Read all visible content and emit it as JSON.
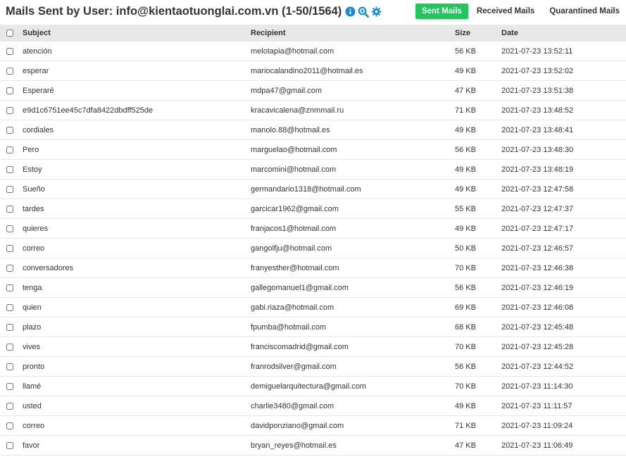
{
  "header": {
    "title": "Mails Sent by User: info@kientaotuonglai.com.vn (1-50/1564)",
    "icons": [
      "info-icon",
      "search-zoom-icon",
      "gear-icon"
    ],
    "accent_color": "#22c55e",
    "icon_color": "#1d8acb"
  },
  "tabs": [
    {
      "label": "Sent Mails",
      "active": true
    },
    {
      "label": "Received Mails",
      "active": false
    },
    {
      "label": "Quarantined Mails",
      "active": false
    }
  ],
  "table": {
    "columns": [
      "Subject",
      "Recipient",
      "Size",
      "Date"
    ],
    "rows": [
      {
        "subject": "atención",
        "recipient": "melotapia@hotmail.com",
        "size": "56 KB",
        "date": "2021-07-23 13:52:11"
      },
      {
        "subject": "esperar",
        "recipient": "mariocalandino2011@hotmail.es",
        "size": "49 KB",
        "date": "2021-07-23 13:52:02"
      },
      {
        "subject": "Esperaré",
        "recipient": "mdpa47@gmail.com",
        "size": "47 KB",
        "date": "2021-07-23 13:51:38"
      },
      {
        "subject": "e9d1c6751ee45c7dfa8422dbdff525de",
        "recipient": "kracavicalena@znmmail.ru",
        "size": "71 KB",
        "date": "2021-07-23 13:48:52"
      },
      {
        "subject": "cordiales",
        "recipient": "manolo.88@hotmail.es",
        "size": "49 KB",
        "date": "2021-07-23 13:48:41"
      },
      {
        "subject": "Pero",
        "recipient": "marguelao@hotmail.com",
        "size": "56 KB",
        "date": "2021-07-23 13:48:30"
      },
      {
        "subject": "Estoy",
        "recipient": "marcomini@hotmail.com",
        "size": "49 KB",
        "date": "2021-07-23 13:48:19"
      },
      {
        "subject": "Sueño",
        "recipient": "germandario1318@hotmail.com",
        "size": "49 KB",
        "date": "2021-07-23 12:47:58"
      },
      {
        "subject": "tardes",
        "recipient": "garcicar1962@gmail.com",
        "size": "55 KB",
        "date": "2021-07-23 12:47:37"
      },
      {
        "subject": "quieres",
        "recipient": "franjacos1@hotmail.com",
        "size": "49 KB",
        "date": "2021-07-23 12:47:17"
      },
      {
        "subject": "correo",
        "recipient": "gangolfju@hotmail.com",
        "size": "50 KB",
        "date": "2021-07-23 12:46:57"
      },
      {
        "subject": "conversadores",
        "recipient": "franyesther@hotmail.com",
        "size": "70 KB",
        "date": "2021-07-23 12:46:38"
      },
      {
        "subject": "tenga",
        "recipient": "gallegomanuel1@gmail.com",
        "size": "56 KB",
        "date": "2021-07-23 12:46:19"
      },
      {
        "subject": "quien",
        "recipient": "gabi.riaza@hotmail.com",
        "size": "69 KB",
        "date": "2021-07-23 12:46:08"
      },
      {
        "subject": "plazo",
        "recipient": "fpumba@hotmail.com",
        "size": "68 KB",
        "date": "2021-07-23 12:45:48"
      },
      {
        "subject": "vives",
        "recipient": "franciscomadrid@gmail.com",
        "size": "70 KB",
        "date": "2021-07-23 12:45:28"
      },
      {
        "subject": "pronto",
        "recipient": "franrodsilver@gmail.com",
        "size": "56 KB",
        "date": "2021-07-23 12:44:52"
      },
      {
        "subject": "llamé",
        "recipient": "demiguelarquitectura@gmail.com",
        "size": "70 KB",
        "date": "2021-07-23 11:14:30"
      },
      {
        "subject": "usted",
        "recipient": "charlie3480@gmail.com",
        "size": "49 KB",
        "date": "2021-07-23 11:11:57"
      },
      {
        "subject": "correo",
        "recipient": "davidponziano@gmail.com",
        "size": "71 KB",
        "date": "2021-07-23 11:09:24"
      },
      {
        "subject": "favor",
        "recipient": "bryan_reyes@hotmail.es",
        "size": "47 KB",
        "date": "2021-07-23 11:06:49"
      }
    ]
  }
}
